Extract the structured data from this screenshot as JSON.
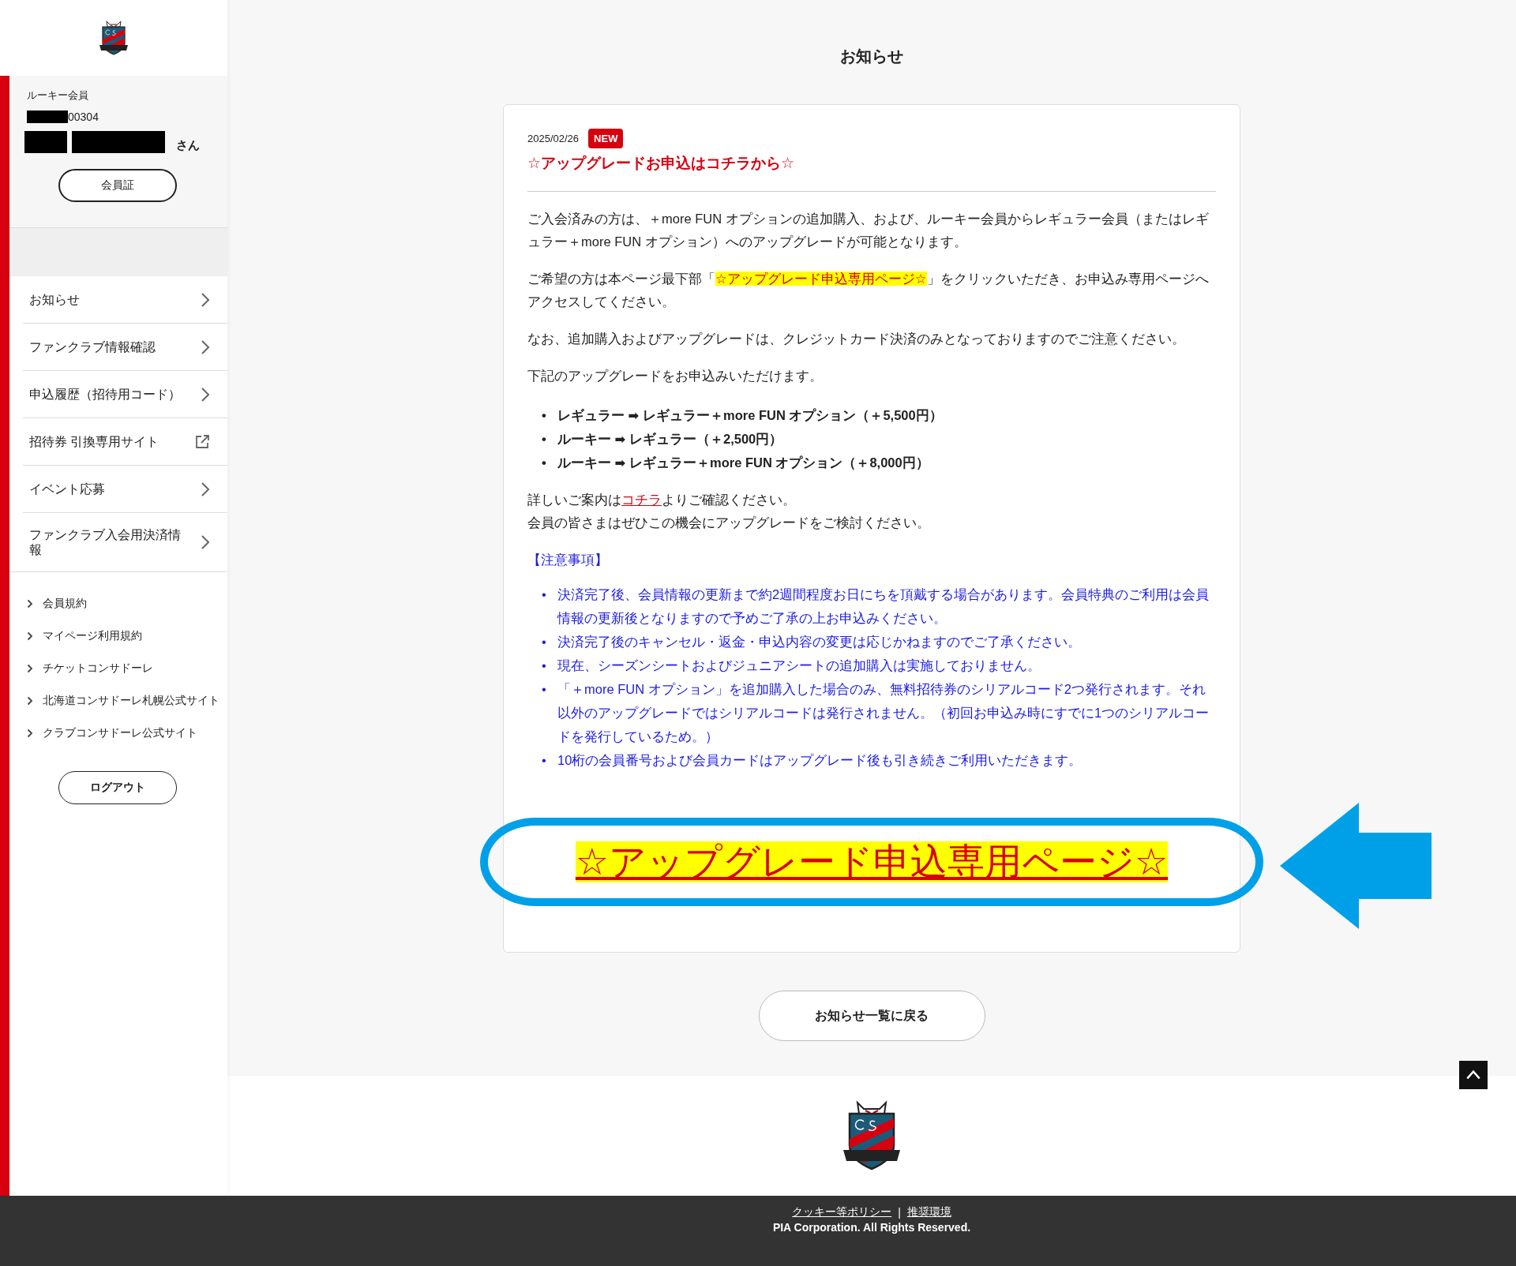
{
  "sidebar": {
    "member_type": "ルーキー会員",
    "member_number": "00304",
    "name_suffix": "さん",
    "card_button": "会員証",
    "nav": [
      {
        "label": "お知らせ",
        "kind": "chevron"
      },
      {
        "label": "ファンクラブ情報確認",
        "kind": "chevron"
      },
      {
        "label": "申込履歴（招待用コード）",
        "kind": "chevron"
      },
      {
        "label": "招待券 引換専用サイト",
        "kind": "external"
      },
      {
        "label": "イベント応募",
        "kind": "chevron"
      },
      {
        "label": "ファンクラブ入会用決済情報",
        "kind": "chevron"
      }
    ],
    "links": [
      "会員規約",
      "マイページ利用規約",
      "チケットコンサドーレ",
      "北海道コンサドーレ札幌公式サイト",
      "クラブコンサドーレ公式サイト"
    ],
    "logout": "ログアウト"
  },
  "page_title": "お知らせ",
  "notice": {
    "date": "2025/02/26",
    "badge": "NEW",
    "title": "☆アップグレードお申込はコチラから☆",
    "paragraphs": [
      [
        {
          "kind": "text",
          "text": "ご入会済みの方は、＋more FUN オプションの追加購入、および、ルーキー会員からレギュラー会員（またはレギュラー＋more FUN オプション）へのアップグレードが可能となります。"
        }
      ],
      [
        {
          "kind": "text",
          "text": "ご希望の方は本ページ最下部「"
        },
        {
          "kind": "highlight",
          "text": "☆アップグレード申込専用ページ☆"
        },
        {
          "kind": "text",
          "text": "」をクリックいただき、お申込み専用ページへアクセスしてください。"
        }
      ],
      [
        {
          "kind": "text",
          "text": "なお、追加購入およびアップグレードは、クレジットカード決済のみとなっておりますのでご注意ください。"
        }
      ],
      [
        {
          "kind": "text",
          "text": "下記のアップグレードをお申込みいただけます。"
        }
      ]
    ],
    "upgrades": [
      "レギュラー ➡ レギュラー＋more FUN オプション（＋5,500円）",
      "ルーキー ➡ レギュラー（＋2,500円）",
      "ルーキー ➡  レギュラー＋more FUN オプション（＋8,000円）"
    ],
    "details": [
      [
        {
          "kind": "text",
          "text": "詳しいご案内は"
        },
        {
          "kind": "link",
          "text": "コチラ"
        },
        {
          "kind": "text",
          "text": "よりご確認ください。"
        }
      ],
      [
        {
          "kind": "text",
          "text": "会員の皆さまはぜひこの機会にアップグレードをご検討ください。"
        }
      ]
    ],
    "notes_heading": "【注意事項】",
    "notes": [
      "決済完了後、会員情報の更新まで約2週間程度お日にちを頂戴する場合があります。会員特典のご利用は会員情報の更新後となりますので予めご了承の上お申込みください。",
      "決済完了後のキャンセル・返金・申込内容の変更は応じかねますのでご了承ください。",
      "現在、シーズンシートおよびジュニアシートの追加購入は実施しておりません。",
      "「＋more FUN オプション」を追加購入した場合のみ、無料招待券のシリアルコード2つ発行されます。それ以外のアップグレードではシリアルコードは発行されません。（初回お申込み時にすでに1つのシリアルコードを発行しているため。）",
      "10桁の会員番号および会員カードはアップグレード後も引き続きご利用いただきます。"
    ],
    "upgrade_link": "☆アップグレード申込専用ページ☆",
    "bullet": "•"
  },
  "back_button": "お知らせ一覧に戻る",
  "footer": {
    "links": [
      "クッキー等ポリシー",
      "推奨環境"
    ],
    "separator": "|",
    "copyright": "PIA Corporation. All Rights Reserved."
  }
}
